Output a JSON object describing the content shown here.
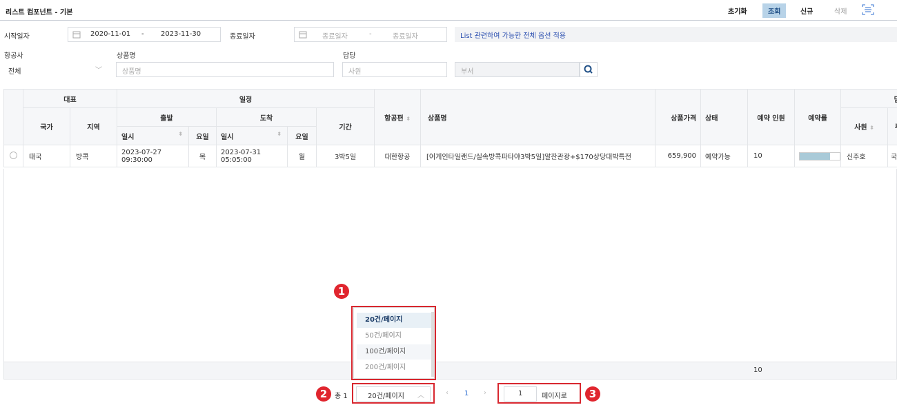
{
  "header": {
    "title": "리스트 컴포넌트 - 기본",
    "reset": "초기화",
    "search": "조회",
    "new": "신규",
    "delete": "삭제"
  },
  "filters": {
    "start_label": "시작일자",
    "start_from": "2020-11-01",
    "start_sep": "-",
    "start_to": "2023-11-30",
    "end_label": "종료일자",
    "end_from_ph": "종료일자",
    "end_sep": "-",
    "end_to_ph": "종료일자",
    "notice": "List 관련하여 가능한 전체 옵션 적용",
    "airline_label": "항공사",
    "airline_value": "전체",
    "product_label": "상품명",
    "product_ph": "상품명",
    "manager_label": "담당",
    "staff_ph": "사원",
    "dept_ph": "부서"
  },
  "table": {
    "h_rep": "대표",
    "h_sched": "일정",
    "h_depart": "출발",
    "h_arrive": "도착",
    "h_country": "국가",
    "h_region": "지역",
    "h_datetime": "일시",
    "h_dow": "요일",
    "h_period": "기간",
    "h_flight": "항공편",
    "h_product": "상품명",
    "h_price": "상품가격",
    "h_status": "상태",
    "h_people": "예약 인원",
    "h_rate": "예약률",
    "h_manager": "담당",
    "h_staff": "사원",
    "h_dept": "부",
    "row": {
      "country": "태국",
      "region": "방콕",
      "dep_dt": "2023-07-27 09:30:00",
      "dep_dow": "목",
      "arr_dt": "2023-07-31 05:05:00",
      "arr_dow": "월",
      "period": "3박5일",
      "flight": "대한항공",
      "product": "[어게인타일랜드/실속방콕파타야3박5일]알찬관광+$170상당대박특전",
      "price": "659,900",
      "status": "예약가능",
      "people": "10",
      "rate": 0.75,
      "staff": "신주호",
      "dept": "국"
    },
    "footer_people": "10"
  },
  "pager": {
    "total": "총 1",
    "page_size": "20건/페이지",
    "current": "1",
    "goto_value": "1",
    "goto_label": "페이지로",
    "options": [
      "20건/페이지",
      "50건/페이지",
      "100건/페이지",
      "200건/페이지"
    ]
  },
  "badges": [
    "1",
    "2",
    "3"
  ]
}
